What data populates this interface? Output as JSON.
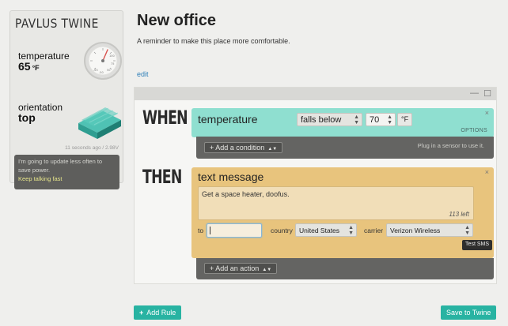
{
  "device": {
    "name": "PAVLUS TWINE",
    "temperature_label": "temperature",
    "temperature_value": "65",
    "temperature_unit": "°F",
    "gauge_ticks": [
      "100",
      "75",
      "50",
      "-25",
      "-50"
    ],
    "orientation_label": "orientation",
    "orientation_value": "top",
    "updated": "11 seconds ago / 2.98V",
    "speech_text": "I'm going to update less often to save power.",
    "speech_link": "Keep talking fast"
  },
  "header": {
    "title": "New office",
    "subtitle": "A reminder to make this place more comfortable.",
    "edit": "edit"
  },
  "rule": {
    "minimize_icon": "—",
    "maximize_icon": "☐",
    "when": {
      "heading": "WHEN",
      "sensor": "temperature",
      "condition": "falls below",
      "value": "70",
      "unit": "°F",
      "options": "OPTIONS",
      "close": "×",
      "add_condition": "+ Add a condition",
      "hint": "Plug in a sensor to use it."
    },
    "then": {
      "heading": "THEN",
      "action": "text message",
      "close": "×",
      "message": "Get a space heater, doofus.",
      "char_count": "113 left",
      "to_label": "to",
      "to_value": "",
      "country_label": "country",
      "country": "United States",
      "carrier_label": "carrier",
      "carrier": "Verizon Wireless",
      "test_button": "Test SMS",
      "add_action": "+ Add an action"
    }
  },
  "footer": {
    "add_rule": "Add Rule",
    "save": "Save to Twine"
  },
  "colors": {
    "accent": "#28b3a2",
    "when_card": "#8fdfd0",
    "then_card": "#e8c47d",
    "dark_bar": "#646462"
  }
}
